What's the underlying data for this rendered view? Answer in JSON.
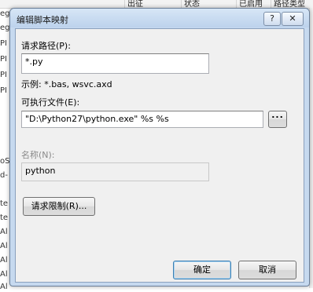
{
  "background": {
    "columns": [
      "出征",
      "状态",
      "已启用",
      "路径类型"
    ],
    "left_rows": [
      "egi",
      "egi",
      "PI",
      "PI",
      "PI",
      "PI",
      "oSe",
      "d-",
      "te",
      "te",
      "Al",
      "Al",
      "Al",
      "Al",
      "Al"
    ]
  },
  "dialog": {
    "title": "编辑脚本映射",
    "help_glyph": "?",
    "close_glyph": "✕",
    "request_path_label": "请求路径(P):",
    "request_path_value": "*.py",
    "example_text": "示例: *.bas, wsvc.axd",
    "executable_label": "可执行文件(E):",
    "executable_value": "\"D:\\Python27\\python.exe\" %s %s",
    "browse_label": "...",
    "name_label": "名称(N):",
    "name_value": "python",
    "restrictions_label": "请求限制(R)...",
    "ok_label": "确定",
    "cancel_label": "取消"
  },
  "colors": {
    "frame": "#c6d9ef",
    "client": "#f0f0f0",
    "disabled_text": "#8a8a8a"
  }
}
